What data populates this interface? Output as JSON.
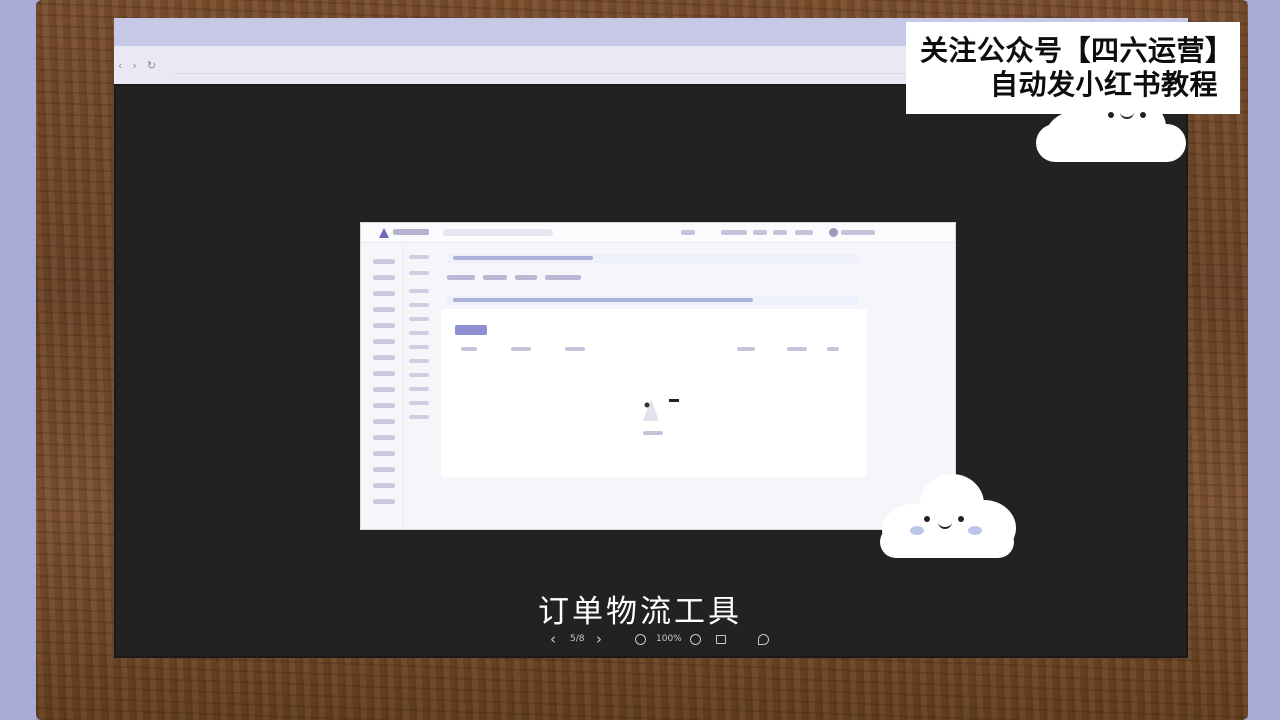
{
  "banner": {
    "line1": "关注公众号【四六运营】",
    "line2": "自动发小红书教程"
  },
  "caption": "订单物流工具",
  "viewer": {
    "prev_icon": "chevron-left-icon",
    "page_indicator": "5/8",
    "next_icon": "chevron-right-icon",
    "zoom_out_icon": "zoom-out-icon",
    "zoom_level": "100%",
    "zoom_in_icon": "zoom-in-icon",
    "fit_icon": "fit-screen-icon",
    "rotate_icon": "rotate-icon"
  },
  "colors": {
    "frame": "#7a4f2e",
    "board": "#222222",
    "background": "#a9aad6",
    "accent": "#8c8fd0"
  }
}
